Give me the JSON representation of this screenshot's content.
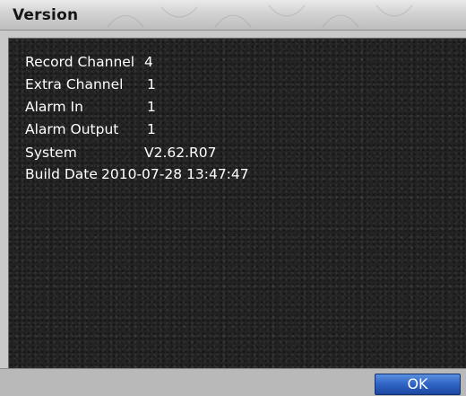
{
  "window": {
    "title": "Version"
  },
  "info": {
    "record_channel_label": "Record Channel",
    "record_channel_value": "4",
    "extra_channel_label": "Extra Channel",
    "extra_channel_value": "1",
    "alarm_in_label": "Alarm In",
    "alarm_in_value": "1",
    "alarm_output_label": "Alarm Output",
    "alarm_output_value": "1",
    "system_label": "System",
    "system_value": "V2.62.R07",
    "build_date_label": "Build Date",
    "build_date_value": "2010-07-28 13:47:47"
  },
  "footer": {
    "ok_label": "OK"
  },
  "colors": {
    "title_bar": "#d2d2d2",
    "panel_bg": "#232323",
    "text": "#ffffff",
    "ok_button": "#2f63c4"
  }
}
